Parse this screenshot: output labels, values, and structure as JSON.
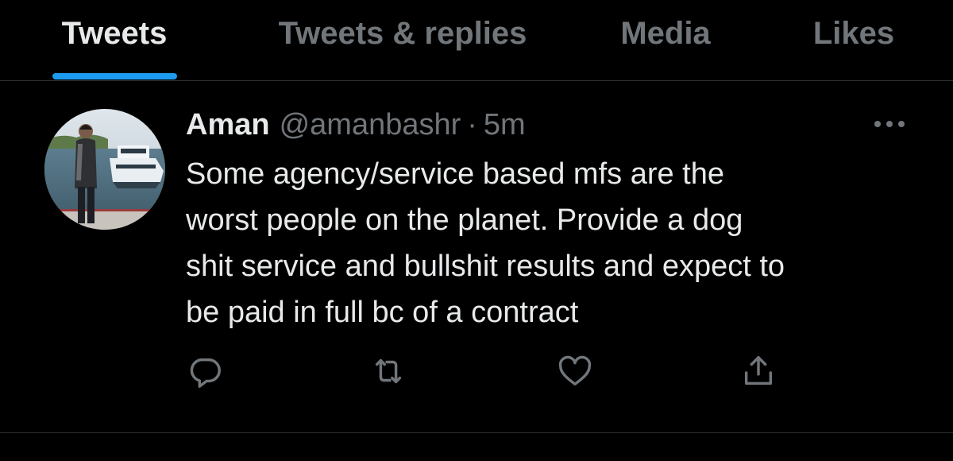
{
  "tabs": [
    {
      "label": "Tweets",
      "active": true
    },
    {
      "label": "Tweets & replies",
      "active": false
    },
    {
      "label": "Media",
      "active": false
    },
    {
      "label": "Likes",
      "active": false
    }
  ],
  "tweet": {
    "name": "Aman",
    "handle": "@amanbashr",
    "separator": "·",
    "time": "5m",
    "text": "Some agency/service based mfs are the\nworst people on the planet. Provide a dog\nshit service and bullshit results and expect to\nbe paid in full bc of a contract",
    "actions": {
      "reply_icon": "reply-icon",
      "retweet_icon": "retweet-icon",
      "like_icon": "heart-icon",
      "share_icon": "share-icon"
    }
  },
  "colors": {
    "background": "#000000",
    "primary_text": "#e7e9ea",
    "secondary_text": "#71767b",
    "accent": "#1d9bf0",
    "divider": "#2f3336"
  }
}
